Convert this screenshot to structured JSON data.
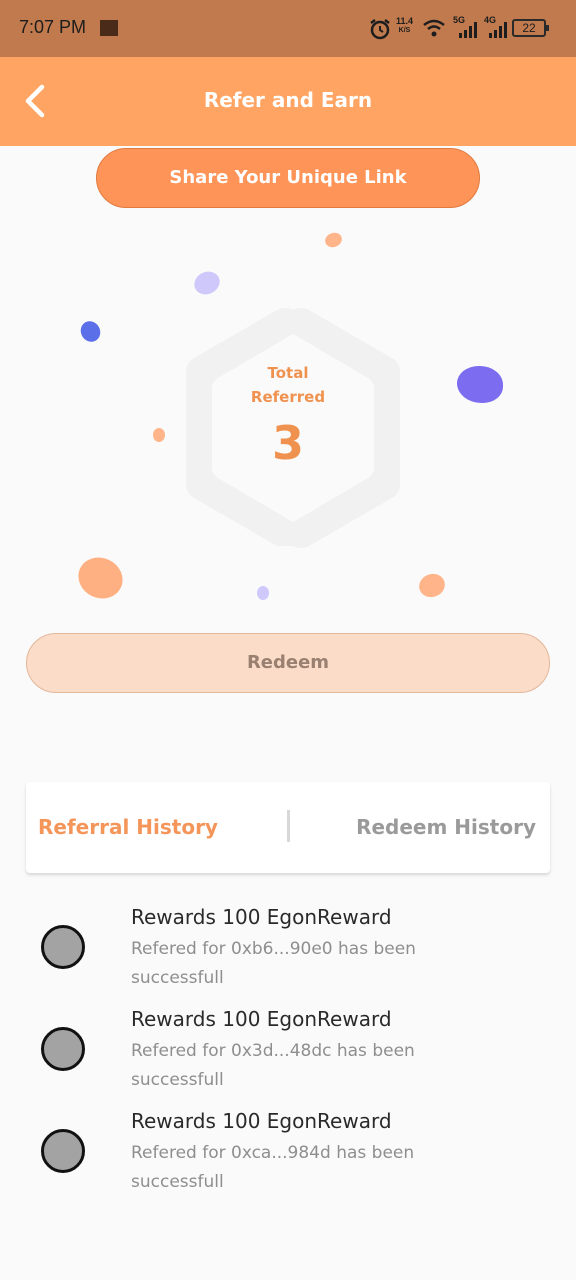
{
  "status_bar": {
    "time": "7:07 PM",
    "net_speed_value": "11.4",
    "net_speed_unit": "K/S",
    "net_5g": "5G",
    "net_4g": "4G",
    "battery": "22"
  },
  "app_bar": {
    "title": "Refer and Earn",
    "back_icon": "chevron-left-icon"
  },
  "share_button": {
    "label": "Share Your Unique Link"
  },
  "stats": {
    "total_label_line1": "Total",
    "total_label_line2": "Referred",
    "total_value": "3"
  },
  "redeem_button": {
    "label": "Redeem"
  },
  "tabs": {
    "referral": "Referral History",
    "redeem": "Redeem History",
    "active": "referral"
  },
  "history": [
    {
      "title": "Rewards 100 EgonReward",
      "description": "Refered for 0xb6...90e0 has been successfull"
    },
    {
      "title": "Rewards 100 EgonReward",
      "description": "Refered for 0x3d...48dc has been successfull"
    },
    {
      "title": "Rewards 100 EgonReward",
      "description": "Refered for 0xca...984d has been successfull"
    }
  ],
  "colors": {
    "accent": "#ffa463",
    "status_bar": "#c07a4e",
    "blob_purple": "#7b6cf0",
    "blob_blue": "#5a6fe8",
    "blob_orange": "#ffb082"
  }
}
